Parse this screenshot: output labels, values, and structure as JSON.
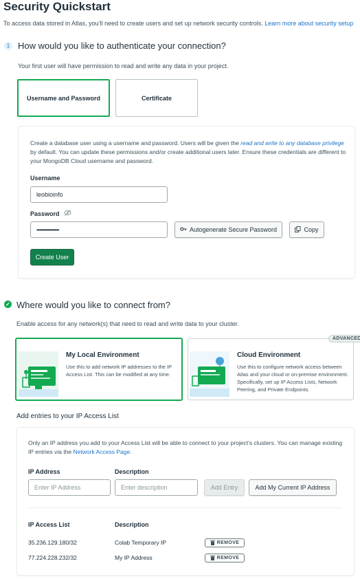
{
  "page": {
    "title": "Security Quickstart",
    "intro": "To access data stored in Atlas, you’ll need to create users and set up network security controls.",
    "intro_link": "Learn more about security setup"
  },
  "step1": {
    "number": "1",
    "heading": "How would you like to authenticate your connection?",
    "subtext": "Your first user will have permission to read and write any data in your project.",
    "options": [
      "Username and Password",
      "Certificate"
    ],
    "selected_option": "Username and Password",
    "desc_part1": "Create a database user using a username and password. Users will be given the ",
    "desc_emphasis": "read and write to any database privilege",
    "desc_part2": " by default. You can update these permissions and/or create additional users later. Ensure these credentials are different to your MongoDB Cloud username and password.",
    "username_label": "Username",
    "username_value": "leobioinfo",
    "password_label": "Password",
    "password_value": "••••••••••••••••••",
    "autogen_label": "Autogenerate Secure Password",
    "copy_label": "Copy",
    "create_user_label": "Create User"
  },
  "step2": {
    "heading": "Where would you like to connect from?",
    "subtext": "Enable access for any network(s) that need to read and write data to your cluster.",
    "local": {
      "title": "My Local Environment",
      "desc": "Use this to add network IP addresses to the IP Access List. This can be modified at any time."
    },
    "cloud": {
      "badge": "ADVANCED",
      "title": "Cloud Environment",
      "desc": "Use this to configure network access between Atlas and your cloud or on-premise environment. Specifically, set up IP Access Lists, Network Peering, and Private Endpoints."
    },
    "ip_section_title": "Add entries to your IP Access List",
    "ip_desc": "Only an IP address you add to your Access List will be able to connect to your project’s clusters. You can manage existing IP entries via the",
    "ip_desc_link": "Network Access Page.",
    "ip_label": "IP Address",
    "desc_label": "Description",
    "ip_placeholder": "Enter IP Address",
    "desc_placeholder": "Enter description",
    "add_entry_label": "Add Entry",
    "add_current_label": "Add My Current IP Address",
    "list_header_ip": "IP Access List",
    "list_header_desc": "Description",
    "remove_label": "REMOVE",
    "entries": [
      {
        "ip": "35.236.129.180/32",
        "description": "Colab Temporary IP"
      },
      {
        "ip": "77.224.228.232/32",
        "description": "My IP Address"
      }
    ]
  },
  "colors": {
    "accent_green": "#13aa52",
    "button_green": "#13814d",
    "link_blue": "#1a73c9",
    "text_dark": "#21313c"
  },
  "icons": [
    "key-icon",
    "copy-icon",
    "eye-slash-icon",
    "trash-icon",
    "check-circle-icon",
    "local-environment-illustration",
    "cloud-environment-illustration"
  ]
}
